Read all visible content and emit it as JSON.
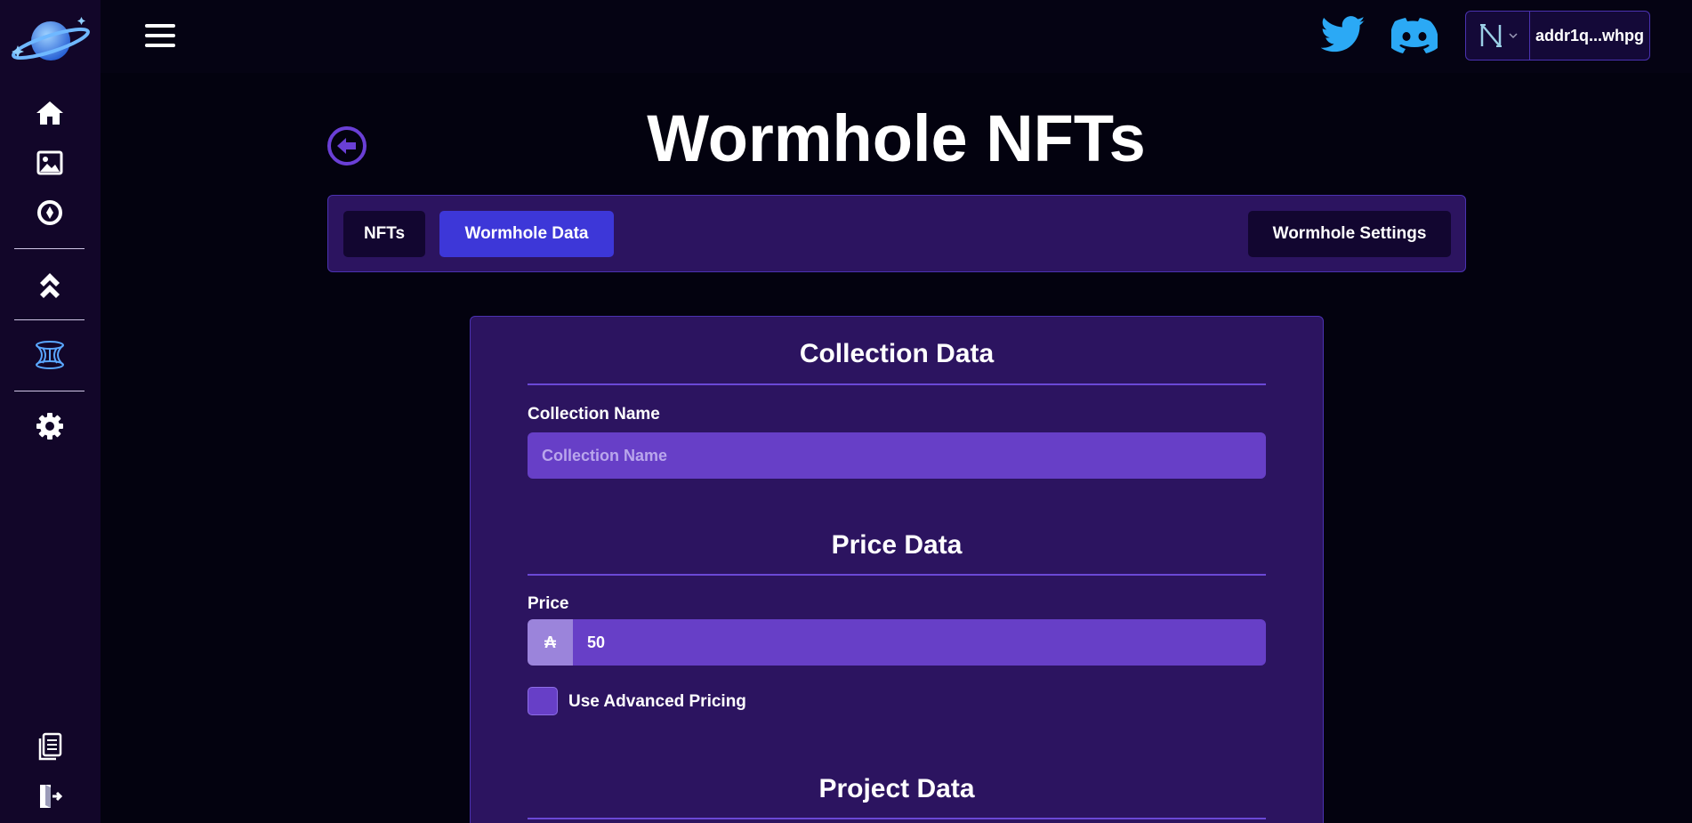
{
  "header": {
    "wallet_address": "addr1q...whpg",
    "wallet_icon": "nami-wallet-icon"
  },
  "sidebar": {
    "items": [
      {
        "icon": "home-icon"
      },
      {
        "icon": "image-icon"
      },
      {
        "icon": "compass-icon"
      },
      {
        "icon": "chevrons-up-icon"
      },
      {
        "icon": "wormhole-icon"
      },
      {
        "icon": "gear-icon"
      },
      {
        "icon": "document-icon"
      },
      {
        "icon": "logout-icon"
      }
    ]
  },
  "page": {
    "title": "Wormhole NFTs"
  },
  "tabs": {
    "nfts": "NFTs",
    "wormhole_data": "Wormhole Data",
    "wormhole_settings": "Wormhole Settings"
  },
  "form": {
    "collection_section": "Collection Data",
    "collection_name_label": "Collection Name",
    "collection_name_placeholder": "Collection Name",
    "collection_name_value": "",
    "price_section": "Price Data",
    "price_label": "Price",
    "price_currency_symbol": "₳",
    "price_value": "50",
    "advanced_pricing_label": "Use Advanced Pricing",
    "advanced_pricing_checked": false,
    "project_section": "Project Data"
  },
  "colors": {
    "accent": "#3d37d8",
    "panel": "#2c1460",
    "input": "#673fc7",
    "icon_blue": "#2ba9f5"
  }
}
